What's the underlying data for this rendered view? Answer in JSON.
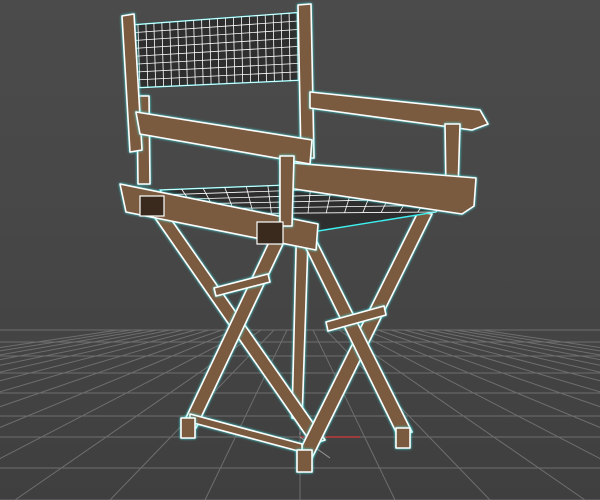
{
  "viewport": {
    "name": "Perspective",
    "background_color": "#444444",
    "grid_color": "#6e6e6e",
    "grid_axis_color": "#222222",
    "x_axis_color": "#d23a3a",
    "y_axis_color": "#9a9a9a"
  },
  "model": {
    "object": "director-chair",
    "display_mode": "wireframe-over-shaded",
    "wood_color": "#7a5b40",
    "wood_dark_color": "#3a2a1e",
    "wire_color": "#ffffff",
    "selection_outline_color": "#3ff0f0",
    "fabric_color": "#2e2e2e"
  }
}
